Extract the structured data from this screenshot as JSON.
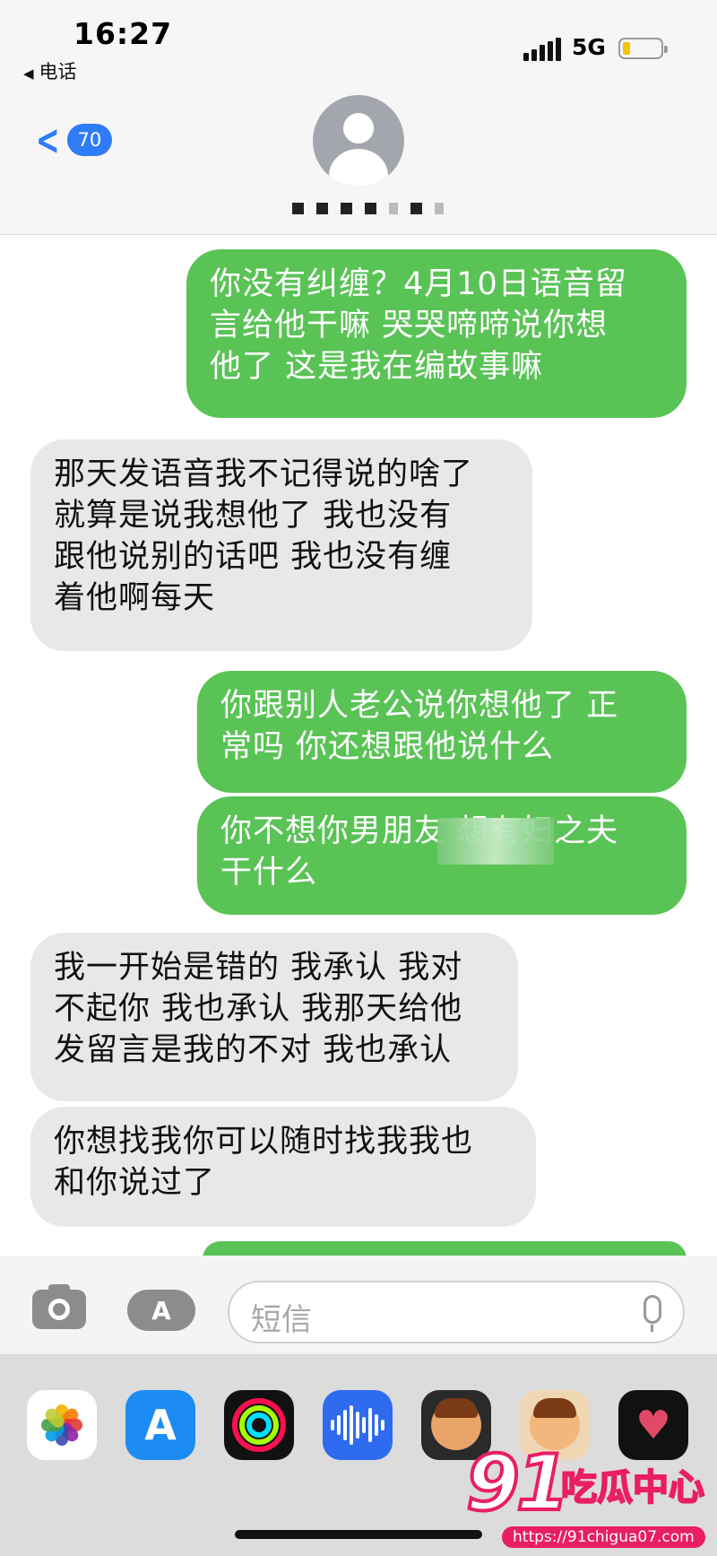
{
  "status_bar": {
    "time": "16:27",
    "back_app": "电话",
    "network": "5G",
    "battery_level": 0.18
  },
  "header": {
    "back_badge": "70",
    "accent_color": "#2f7cf6"
  },
  "messages": [
    {
      "direction": "outgoing",
      "text": "你没有纠缠？4月10日语音留\n言给他干嘛  哭哭啼啼说你想\n他了  这是我在编故事嘛"
    },
    {
      "direction": "incoming",
      "text": "那天发语音我不记得说的啥了\n就算是说我想他了 我也没有\n跟他说别的话吧 我也没有缠\n着他啊每天"
    },
    {
      "direction": "outgoing",
      "text": "你跟别人老公说你想他了  正\n常吗  你还想跟他说什么"
    },
    {
      "direction": "outgoing",
      "text": "你不想你男朋友 想有妇之夫\n干什么"
    },
    {
      "direction": "incoming",
      "text": "我一开始是错的 我承认 我对\n不起你 我也承认 我那天给他\n发留言是我的不对 我也承认"
    },
    {
      "direction": "incoming",
      "text": "你想找我你可以随时找我我也\n和你说过了"
    }
  ],
  "compose": {
    "placeholder": "短信"
  },
  "drawer": {
    "apps": [
      "photos-icon",
      "app-store-icon",
      "fitness-icon",
      "voice-memo-icon",
      "memoji-icon",
      "stickers-icon",
      "digital-touch-icon"
    ]
  },
  "watermark": {
    "number": "91",
    "brand": "吃瓜中心",
    "url": "https://91chigua07.com"
  }
}
